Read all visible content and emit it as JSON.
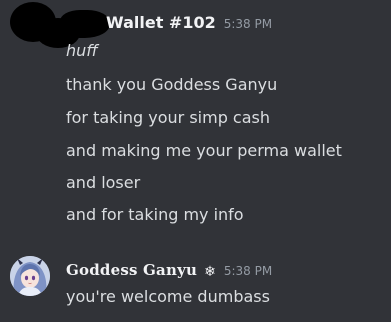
{
  "messages": [
    {
      "username": "Wallet #102",
      "timestamp": "5:38 PM",
      "lines": [
        {
          "text": "huff",
          "italic": true
        },
        {
          "text": "thank you Goddess Ganyu",
          "italic": false
        },
        {
          "text": "for taking your simp cash",
          "italic": false
        },
        {
          "text": "and making me your perma wallet",
          "italic": false
        },
        {
          "text": "and loser",
          "italic": false
        },
        {
          "text": "and for taking my info",
          "italic": false
        }
      ],
      "avatar_icon": "redacted-avatar"
    },
    {
      "username": "Goddess Ganyu",
      "badge_icon": "snowflake-icon",
      "badge_glyph": "❄",
      "timestamp": "5:38 PM",
      "lines": [
        {
          "text": "you're welcome dumbass",
          "italic": false
        }
      ],
      "avatar_icon": "anime-character-avatar"
    }
  ],
  "colors": {
    "background": "#313338",
    "username": "#f2f3f5",
    "message_text": "#dbdee1",
    "timestamp": "#949ba4"
  }
}
